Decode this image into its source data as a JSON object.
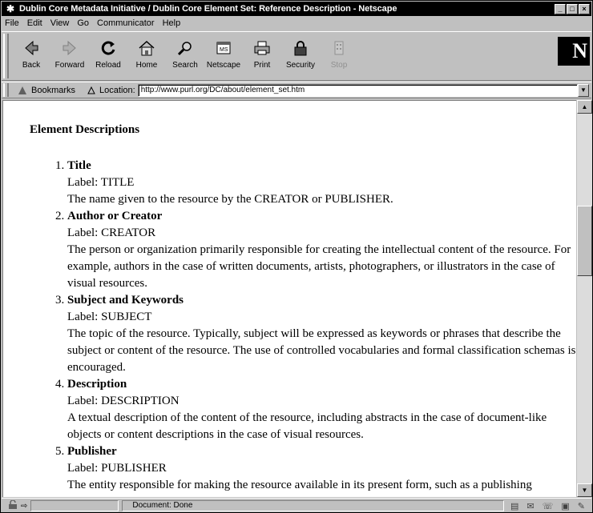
{
  "window": {
    "title": "Dublin Core Metadata Initiative / Dublin Core Element Set: Reference Description - Netscape"
  },
  "menu": [
    "File",
    "Edit",
    "View",
    "Go",
    "Communicator",
    "Help"
  ],
  "toolbar": {
    "buttons": [
      {
        "label": "Back",
        "icon": "back-arrow-icon"
      },
      {
        "label": "Forward",
        "icon": "forward-arrow-icon"
      },
      {
        "label": "Reload",
        "icon": "reload-icon"
      },
      {
        "label": "Home",
        "icon": "home-icon"
      },
      {
        "label": "Search",
        "icon": "search-icon"
      },
      {
        "label": "Netscape",
        "icon": "netscape-icon"
      },
      {
        "label": "Print",
        "icon": "print-icon"
      },
      {
        "label": "Security",
        "icon": "security-lock-icon"
      },
      {
        "label": "Stop",
        "icon": "stop-icon",
        "disabled": true
      }
    ],
    "logo": "N"
  },
  "location_bar": {
    "bookmarks_label": "Bookmarks",
    "location_label": "Location:",
    "url": "http://www.purl.org/DC/about/element_set.htm"
  },
  "page": {
    "heading": "Element Descriptions",
    "elements": [
      {
        "term": "Title",
        "label": "Label: TITLE",
        "description": "The name given to the resource by the CREATOR or PUBLISHER."
      },
      {
        "term": "Author or Creator",
        "label": "Label: CREATOR",
        "description": "The person or organization primarily responsible for creating the intellectual content of the resource. For example, authors in the case of written documents, artists, photographers, or illustrators in the case of visual resources."
      },
      {
        "term": "Subject and Keywords",
        "label": "Label: SUBJECT",
        "description": "The topic of the resource. Typically, subject will be expressed as keywords or phrases that describe the subject or content of the resource. The use of controlled vocabularies and formal classification schemas is encouraged."
      },
      {
        "term": "Description",
        "label": "Label: DESCRIPTION",
        "description": "A textual description of the content of the resource, including abstracts in the case of document-like objects or content descriptions in the case of visual resources."
      },
      {
        "term": "Publisher",
        "label": "Label: PUBLISHER",
        "description": "The entity responsible for making the resource available in its present form, such as a publishing"
      }
    ]
  },
  "status": {
    "text": "Document: Done"
  }
}
